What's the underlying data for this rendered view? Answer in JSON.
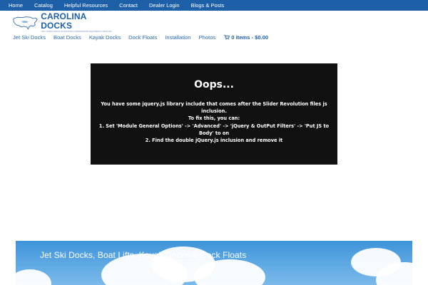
{
  "topnav": {
    "items": [
      "Home",
      "Catalog",
      "Helpful Resources",
      "Contact",
      "Dealer Login",
      "Blogs & Posts"
    ]
  },
  "logo": {
    "title": "CAROLINA DOCKS",
    "tagline": "THE LOWEST PRICE ON BOATING & WATERFRONT EQUIPMENT CAROLINA"
  },
  "mainnav": {
    "items": [
      "Jet Ski Docks",
      "Boat Docks",
      "Kayak Docks",
      "Dock Floats",
      "Installation",
      "Photos"
    ],
    "cart_label": "0 items - $0.00"
  },
  "error": {
    "title": "Oops...",
    "lines": [
      "You have some jquery.js library include that comes after the Slider Revolution files js",
      "inclusion.",
      "To fix this, you can:",
      "1. Set 'Module General Options' -> 'Advanced' -> 'jQuery & OutPut Filters' -> 'Put JS to",
      "Body' to on",
      "2. Find the double jQuery.js inclusion and remove it"
    ]
  },
  "hero": {
    "title": "Jet Ski Docks, Boat Lifts, Kayak Docks & Dock Floats"
  },
  "colors": {
    "topbar": "#1e60a8",
    "link": "#2a6bb0",
    "error_bg": "#111111"
  }
}
